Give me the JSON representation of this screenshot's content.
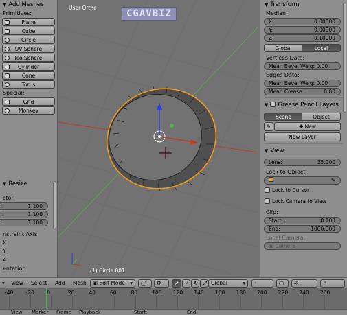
{
  "left_panel": {
    "title": "Add Meshes",
    "primitives_label": "Primitives:",
    "primitives": [
      {
        "label": "Plane",
        "icon": "plane-icon"
      },
      {
        "label": "Cube",
        "icon": "cube-icon"
      },
      {
        "label": "Circle",
        "icon": "circle-icon"
      },
      {
        "label": "UV Sphere",
        "icon": "uv-sphere-icon"
      },
      {
        "label": "Ico Sphere",
        "icon": "ico-sphere-icon"
      },
      {
        "label": "Cylinder",
        "icon": "cylinder-icon"
      },
      {
        "label": "Cone",
        "icon": "cone-icon"
      },
      {
        "label": "Torus",
        "icon": "torus-icon"
      }
    ],
    "special_label": "Special:",
    "special": [
      {
        "label": "Grid",
        "icon": "grid-icon"
      },
      {
        "label": "Monkey",
        "icon": "monkey-icon"
      }
    ],
    "resize": {
      "title": "Resize",
      "vector_label": "ctor",
      "fields": [
        {
          "label": ":",
          "value": "1.100"
        },
        {
          "label": ":",
          "value": "1.100"
        },
        {
          "label": ":",
          "value": "1.100"
        }
      ],
      "constraint_label": "nstraint Axis",
      "axes": [
        "X",
        "Y",
        "Z"
      ],
      "orientation_label": "entation"
    }
  },
  "viewport": {
    "view_name": "User Ortho",
    "watermark": "CGAVBIZ",
    "object_name": "(1) Circle.001"
  },
  "right_panel": {
    "transform_title": "Transform",
    "median_label": "Median:",
    "median": [
      {
        "label": "X:",
        "value": "0.00000"
      },
      {
        "label": "Y:",
        "value": "0.00000"
      },
      {
        "label": "Z:",
        "value": "-0.10000"
      }
    ],
    "space_toggle": {
      "options": [
        "Global",
        "Local"
      ],
      "selected": "Local"
    },
    "vertices_data_label": "Vertices Data:",
    "vertices_bevel": "Mean Bevel Weig: 0.00",
    "edges_data_label": "Edges Data:",
    "edges_bevel": "Mean Bevel Weig: 0.00",
    "edges_crease": {
      "label": "Mean Crease:",
      "value": "0.00"
    },
    "grease_pencil_title": "Grease Pencil Layers",
    "gp_toggle": {
      "options": [
        "Scene",
        "Object"
      ],
      "selected": "Scene"
    },
    "gp_new": "New",
    "gp_new_layer": "New Layer",
    "view_title": "View",
    "lens": {
      "label": "Lens:",
      "value": "35.000"
    },
    "lock_object_label": "Lock to Object:",
    "lock_cursor": "Lock to Cursor",
    "lock_camera": "Lock Camera to View",
    "clip_label": "Clip:",
    "clip_start": {
      "label": "Start:",
      "value": "0.100"
    },
    "clip_end": {
      "label": "End:",
      "value": "1000.000"
    },
    "local_camera_label": "Local Camera:",
    "camera_field": "Camera"
  },
  "header": {
    "menus": [
      "View",
      "Select",
      "Add",
      "Mesh"
    ],
    "mode": "Edit Mode",
    "orientation": "Global"
  },
  "timeline": {
    "ticks": [
      "-40",
      "-20",
      "0",
      "20",
      "40",
      "60",
      "80",
      "100",
      "120",
      "140",
      "160",
      "180",
      "200",
      "220",
      "240",
      "260"
    ]
  },
  "footer": {
    "items": [
      "View",
      "Marker",
      "Frame",
      "Playback",
      "Start:",
      "End:"
    ]
  },
  "colors": {
    "panel_bg": "#8e8e8e",
    "viewport_bg": "#727272",
    "selected_edge": "#f39a1e",
    "x_axis": "#c0392b",
    "y_axis": "#58b04a",
    "z_axis": "#2d3ee0"
  }
}
